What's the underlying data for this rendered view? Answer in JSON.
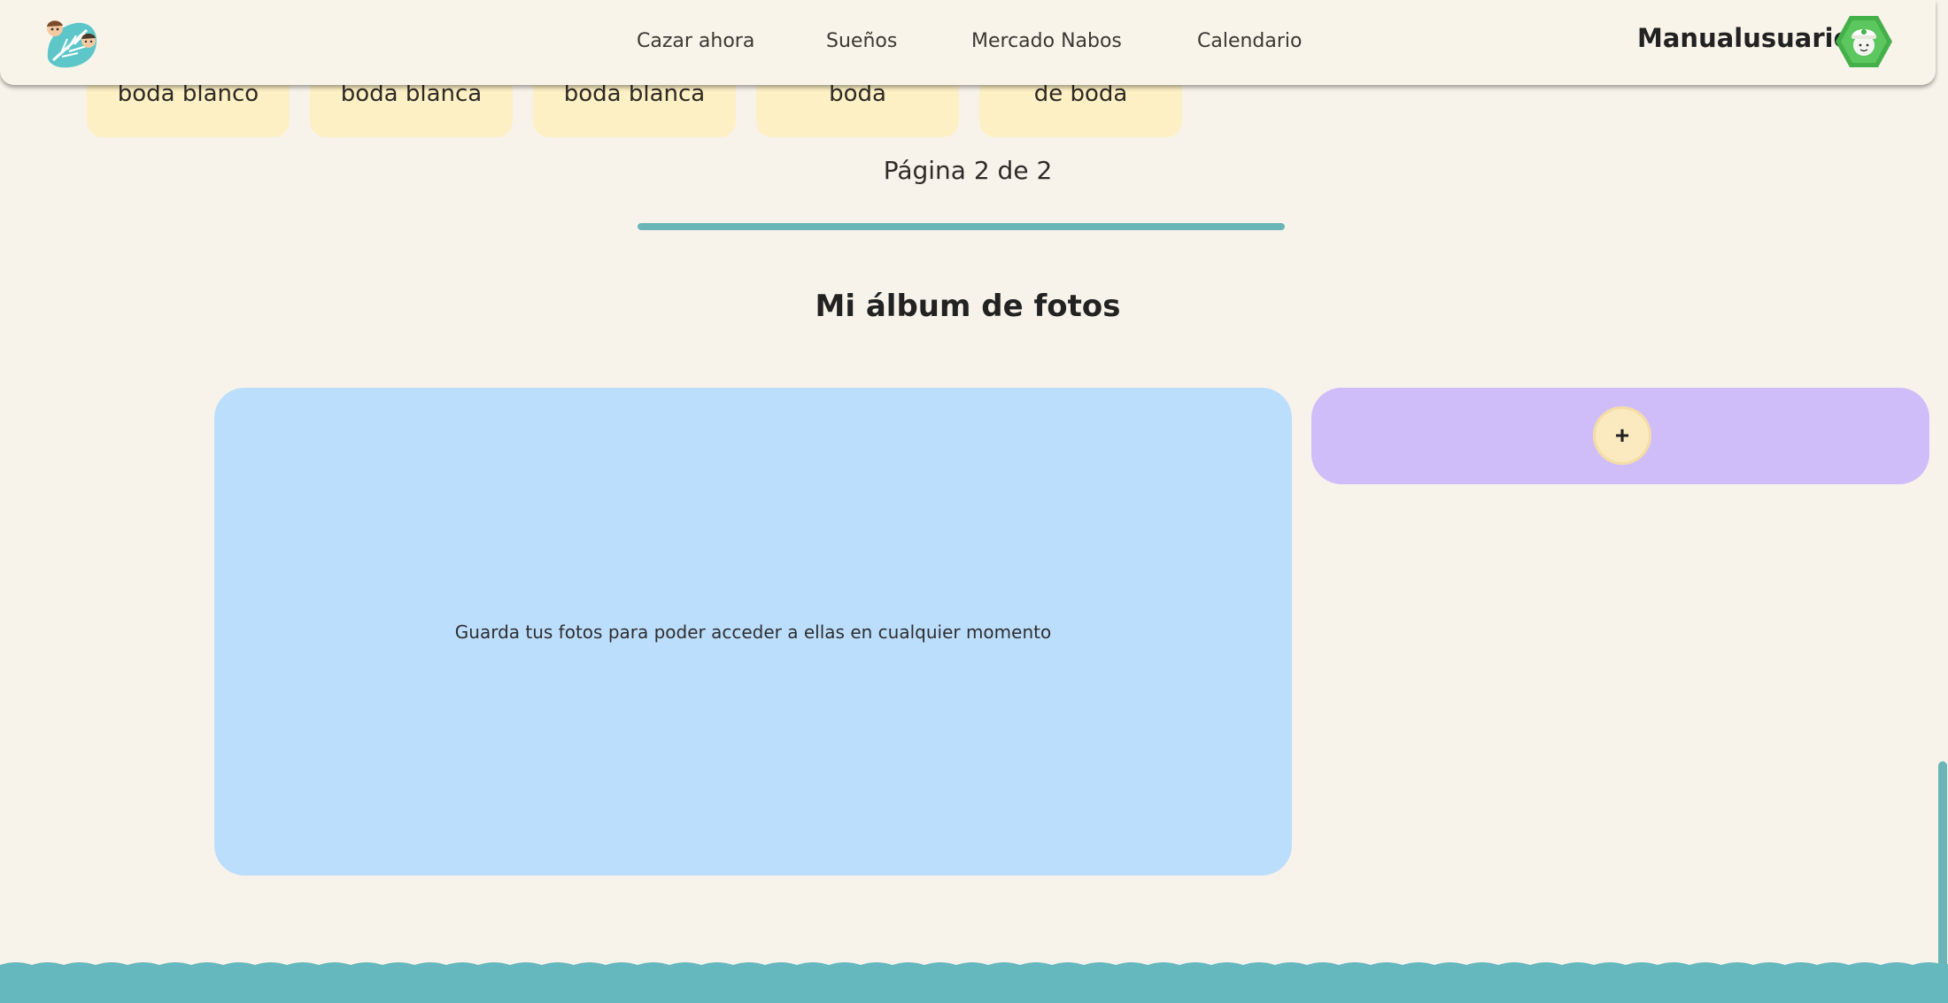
{
  "header": {
    "logo_icon": "leaf-logo-icon",
    "nav": [
      {
        "label": "Cazar ahora"
      },
      {
        "label": "Sueños"
      },
      {
        "label": "Mercado Nabos"
      },
      {
        "label": "Calendario"
      }
    ],
    "username": "Manualusuario",
    "avatar_icon": "villager-avatar-icon"
  },
  "tiles": [
    {
      "label": "boda blanco"
    },
    {
      "label": "boda blanca"
    },
    {
      "label": "boda blanca"
    },
    {
      "label": "boda"
    },
    {
      "label": "de boda"
    }
  ],
  "pagination": {
    "text": "Página 2 de 2",
    "progress": 1.0
  },
  "album": {
    "title": "Mi álbum de fotos",
    "empty_text": "Guarda tus fotos para poder acceder a ellas en cualquier momento",
    "add_label": "+"
  },
  "colors": {
    "background": "#f8f3ea",
    "accent_teal": "#6ab5b7",
    "tile_yellow": "#fdf0c4",
    "album_blue": "#bcdefd",
    "add_purple": "#cfbdfa"
  }
}
